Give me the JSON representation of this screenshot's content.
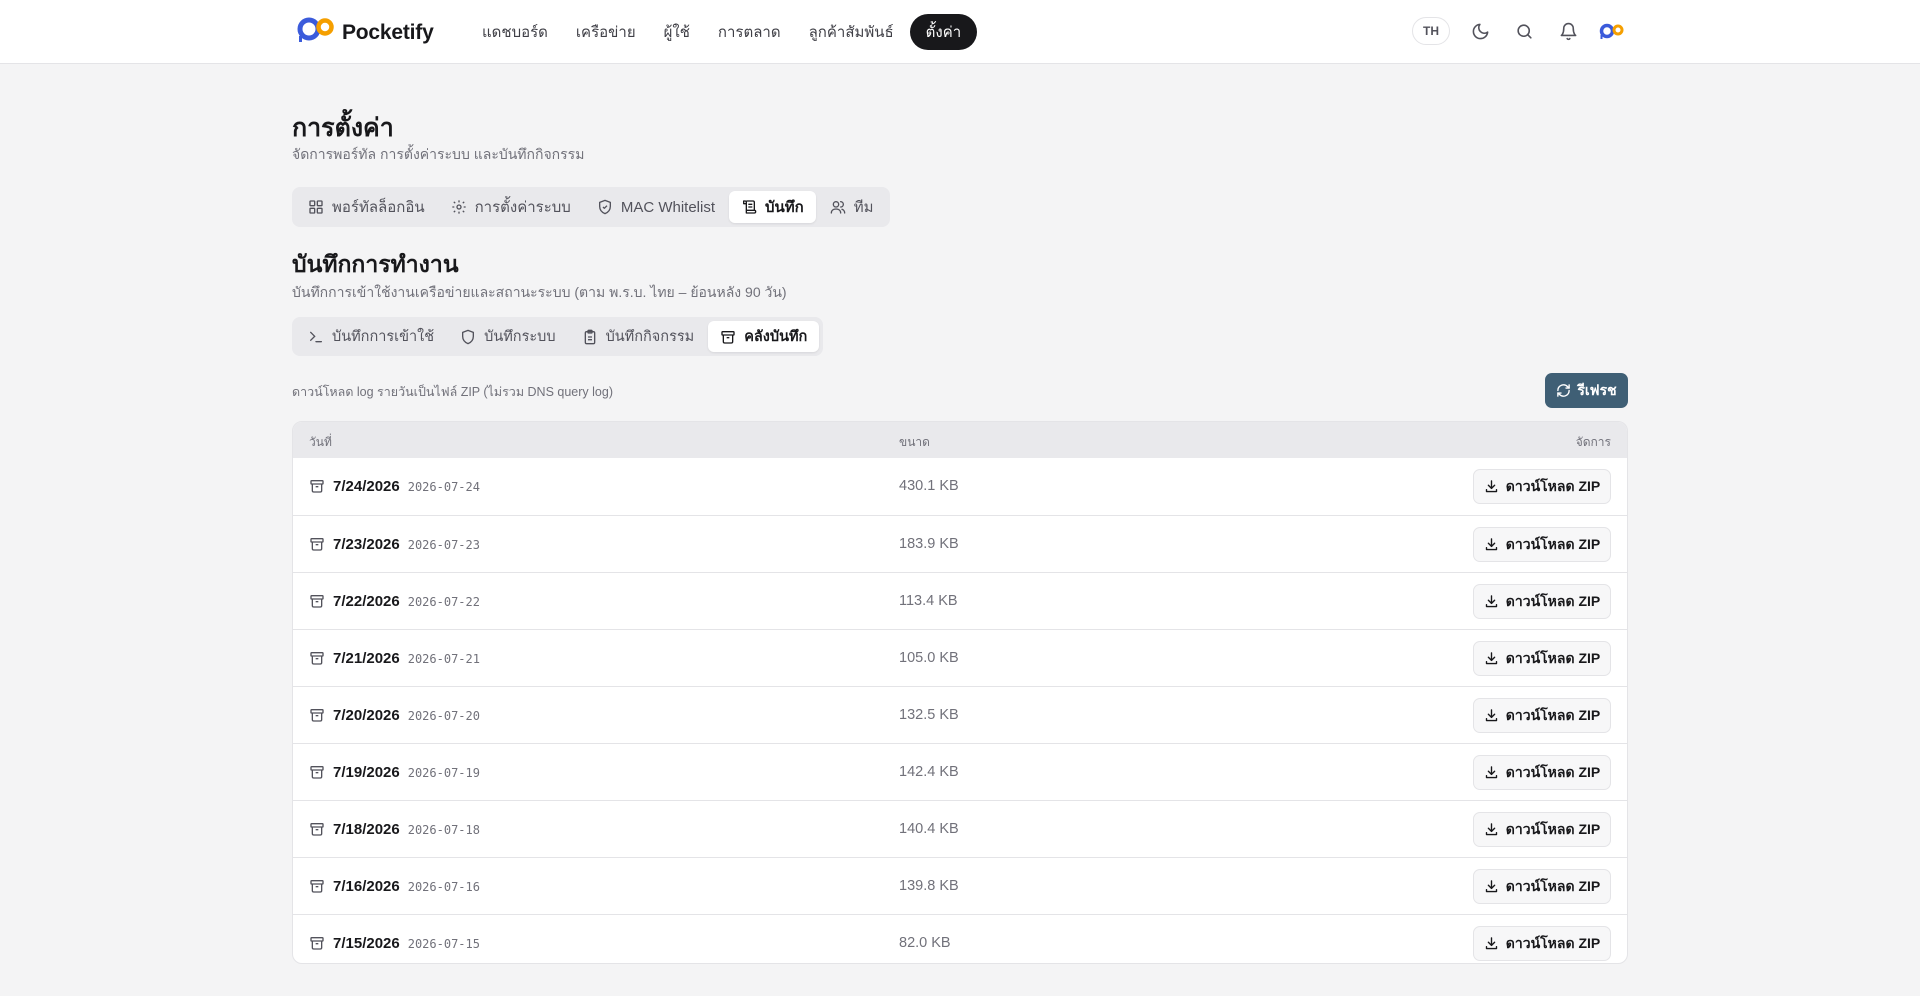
{
  "brand": {
    "name": "Pocketify"
  },
  "nav": {
    "items": [
      {
        "label": "แดชบอร์ด"
      },
      {
        "label": "เครือข่าย"
      },
      {
        "label": "ผู้ใช้"
      },
      {
        "label": "การตลาด"
      },
      {
        "label": "ลูกค้าสัมพันธ์"
      },
      {
        "label": "ตั้งค่า",
        "active": true
      }
    ],
    "lang": "TH",
    "icons": [
      "moon-icon",
      "search-icon",
      "bell-icon",
      "logo-icon"
    ]
  },
  "page": {
    "title": "การตั้งค่า",
    "subtitle": "จัดการพอร์ทัล การตั้งค่าระบบ และบันทึกกิจกรรม"
  },
  "tabs": [
    {
      "label": "พอร์ทัลล็อกอิน",
      "icon": "grid-icon"
    },
    {
      "label": "การตั้งค่าระบบ",
      "icon": "gear-icon"
    },
    {
      "label": "MAC Whitelist",
      "icon": "shield-check-icon"
    },
    {
      "label": "บันทึก",
      "icon": "scroll-icon",
      "active": true
    },
    {
      "label": "ทีม",
      "icon": "users-icon"
    }
  ],
  "section": {
    "title": "บันทึกการทำงาน",
    "subtitle": "บันทึกการเข้าใช้งานเครือข่ายและสถานะระบบ (ตาม พ.ร.บ. ไทย – ย้อนหลัง 90 วัน)"
  },
  "subtabs": [
    {
      "label": "บันทึกการเข้าใช้",
      "icon": "terminal-icon"
    },
    {
      "label": "บันทึกระบบ",
      "icon": "shield-icon"
    },
    {
      "label": "บันทึกกิจกรรม",
      "icon": "clipboard-icon"
    },
    {
      "label": "คลังบันทึก",
      "icon": "archive-icon",
      "active": true
    }
  ],
  "archive": {
    "hint": "ดาวน์โหลด log รายวันเป็นไฟล์ ZIP (ไม่รวม DNS query log)",
    "refresh_label": "รีเฟรช",
    "columns": {
      "date": "วันที่",
      "size": "ขนาด",
      "actions": "จัดการ"
    },
    "download_label": "ดาวน์โหลด ZIP",
    "rows": [
      {
        "date": "7/24/2026",
        "iso": "2026-07-24",
        "size": "430.1 KB"
      },
      {
        "date": "7/23/2026",
        "iso": "2026-07-23",
        "size": "183.9 KB"
      },
      {
        "date": "7/22/2026",
        "iso": "2026-07-22",
        "size": "113.4 KB"
      },
      {
        "date": "7/21/2026",
        "iso": "2026-07-21",
        "size": "105.0 KB"
      },
      {
        "date": "7/20/2026",
        "iso": "2026-07-20",
        "size": "132.5 KB"
      },
      {
        "date": "7/19/2026",
        "iso": "2026-07-19",
        "size": "142.4 KB"
      },
      {
        "date": "7/18/2026",
        "iso": "2026-07-18",
        "size": "140.4 KB"
      },
      {
        "date": "7/16/2026",
        "iso": "2026-07-16",
        "size": "139.8 KB"
      },
      {
        "date": "7/15/2026",
        "iso": "2026-07-15",
        "size": "82.0 KB"
      }
    ]
  },
  "colors": {
    "accent": "#3f5f75",
    "active_nav": "#18181b",
    "brand_blue": "#2563eb",
    "brand_orange": "#f59e0b"
  }
}
